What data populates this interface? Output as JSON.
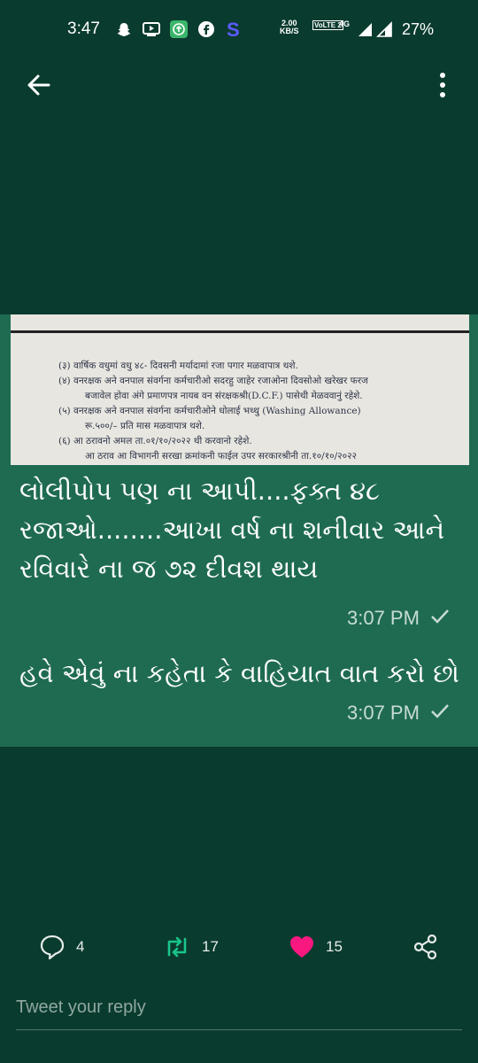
{
  "status_bar": {
    "time": "3:47",
    "speed_value": "2.00",
    "speed_unit": "KB/S",
    "volte": "VoLTE 2",
    "network": "4G",
    "battery": "27%",
    "notification_icons": [
      "snapchat-icon",
      "youtube-icon",
      "green-app-icon",
      "facebook-icon",
      "s-app-icon"
    ]
  },
  "document": {
    "lines": [
      "(३) वार्षिक वधुमां वधु ४८- दिवसनी मर्यादामां रजा पगार मळवापात्र थशे.",
      "(४) वनरक्षक अने वनपाल संवर्गना कर्मचारीओ सदरहु जाहेर रजाओना दिवसोओ खरेखर फरज",
      "बजावेल होवा अंगे प्रमाणपत्र नायब वन संरक्षकश्री(D.C.F.) पासेथी मेळववानुं रहेशे.",
      "(५) वनरक्षक अने वनपाल संवर्गना कर्मचारीओने धोलाई भथ्थु (Washing Allowance)",
      "रू.५००/– प्रति मास मळवापात्र थशे.",
      "(६) आ ठरावनो अमल ता.०१/१०/२०२२ थी करवानो रहेशे.",
      "आ ठराव आ विभागनी सरखा क्रमांकनी फाईल उपर सरकारश्रीनी ता.१०/१०/२०२२"
    ]
  },
  "messages": [
    {
      "text": "લોલીપોપ પણ ના આપી....ફક્ત ૪૮ રજાઓ........આખા વર્ષ ના શનીવાર આને રવિવારે ના જ ૭૨ દીવશ થાય",
      "time": "3:07 PM"
    },
    {
      "text": "હવે એવું ના કહેતા કે વાહિયાત વાત કરો છો",
      "time": "3:07 PM"
    }
  ],
  "actions": {
    "replies": "4",
    "retweets": "17",
    "likes": "15"
  },
  "reply": {
    "placeholder": "Tweet your reply"
  },
  "colors": {
    "background": "#0a3b2f",
    "bubble": "#1f6b52",
    "retweet": "#19c58a",
    "like": "#f91880"
  }
}
